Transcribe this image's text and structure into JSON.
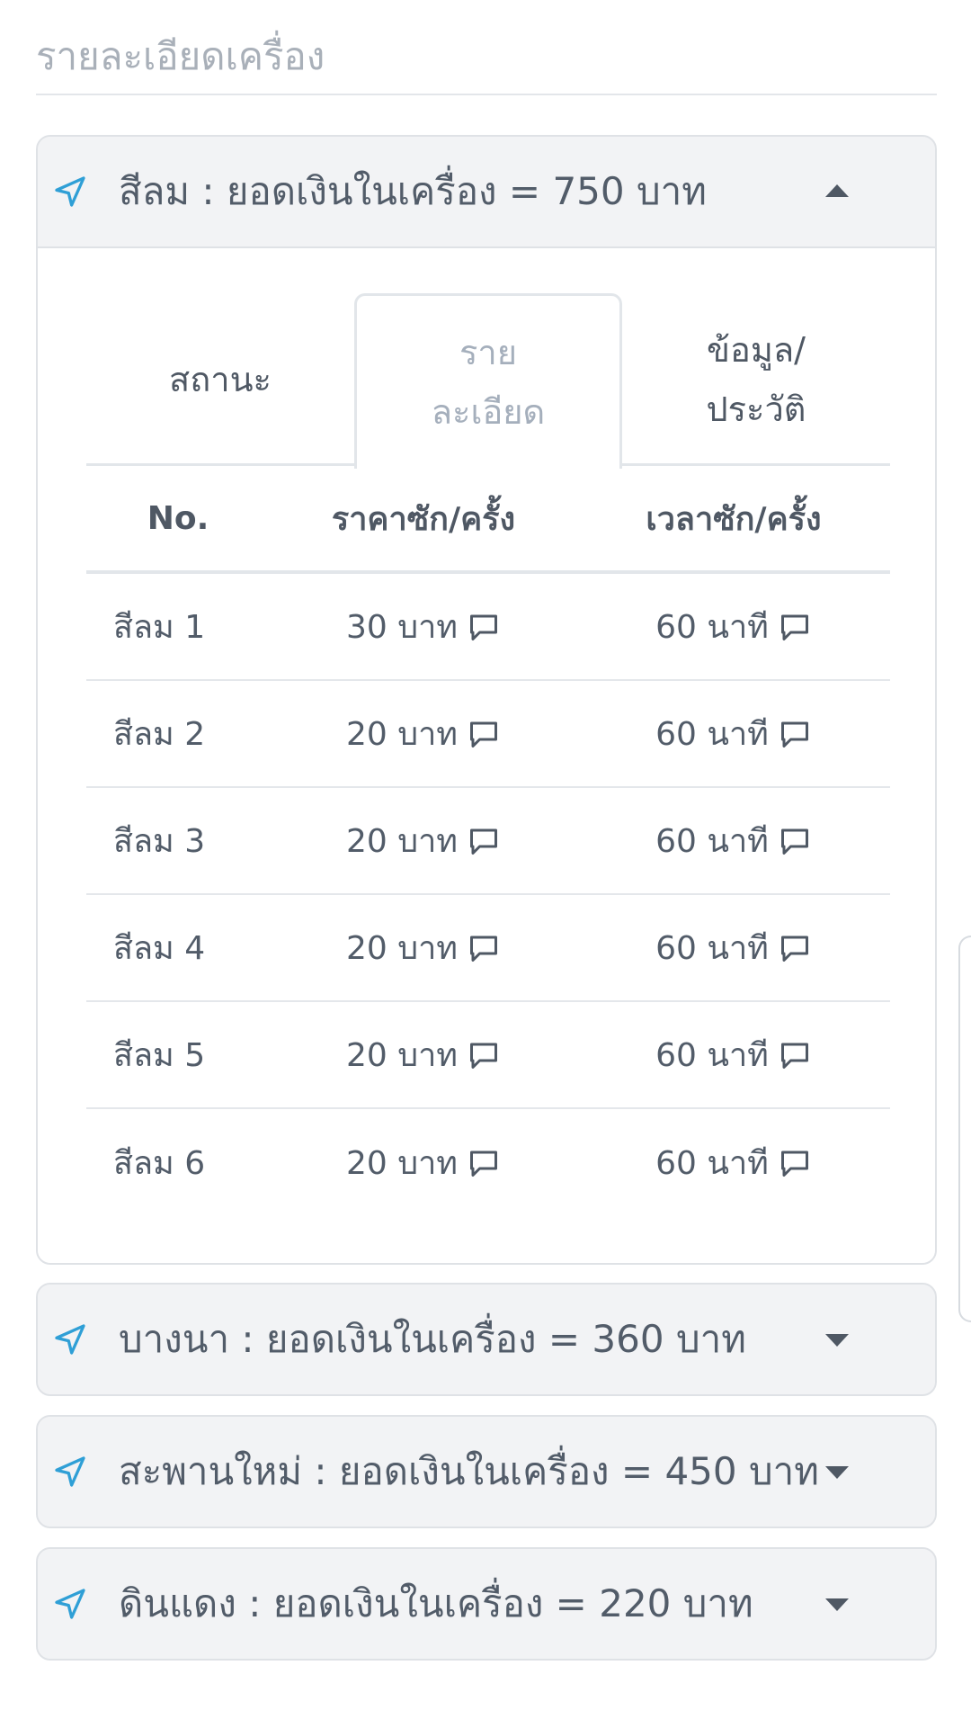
{
  "section": {
    "title": "รายละเอียดเครื่อง"
  },
  "machines": [
    {
      "title": "สีลม : ยอดเงินในเครื่อง = 750 บาท",
      "expanded": true
    },
    {
      "title": "บางนา : ยอดเงินในเครื่อง = 360 บาท",
      "expanded": false
    },
    {
      "title": "สะพานใหม่ : ยอดเงินในเครื่อง = 450 บาท",
      "expanded": false
    },
    {
      "title": "ดินแดง : ยอดเงินในเครื่อง = 220 บาท",
      "expanded": false
    }
  ],
  "tabs": [
    {
      "label_line1": "สถานะ",
      "label_line2": ""
    },
    {
      "label_line1": "ราย",
      "label_line2": "ละเอียด"
    },
    {
      "label_line1": "ข้อมูล/",
      "label_line2": "ประวัติ"
    }
  ],
  "active_tab": "ราย ละเอียด",
  "table": {
    "headers": [
      "No.",
      "ราคาซัก/ครั้ง",
      "เวลาซัก/ครั้ง"
    ],
    "rows": [
      {
        "no": "สีลม 1",
        "price": "30 บาท",
        "time": "60 นาที"
      },
      {
        "no": "สีลม 2",
        "price": "20 บาท",
        "time": "60 นาที"
      },
      {
        "no": "สีลม 3",
        "price": "20 บาท",
        "time": "60 นาที"
      },
      {
        "no": "สีลม 4",
        "price": "20 บาท",
        "time": "60 นาที"
      },
      {
        "no": "สีลม 5",
        "price": "20 บาท",
        "time": "60 นาที"
      },
      {
        "no": "สีลม 6",
        "price": "20 บาท",
        "time": "60 นาที"
      }
    ]
  },
  "icons": {
    "header": "navigation-arrow-icon",
    "cell": "comment-icon",
    "expand": "caret-icon"
  },
  "colors": {
    "accent": "#2f9fd6",
    "header_bg": "#f2f3f5",
    "text": "#525c69",
    "muted": "#a9b0b9"
  }
}
